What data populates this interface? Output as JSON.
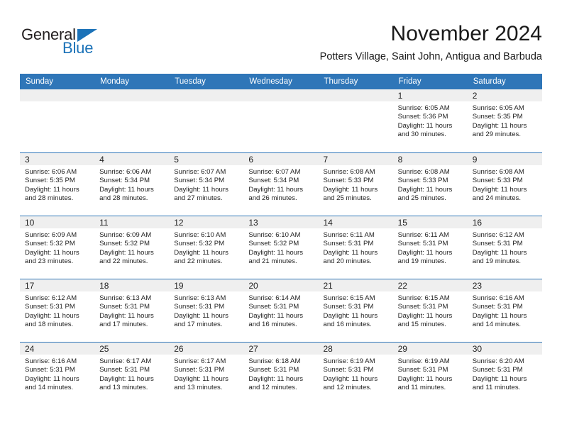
{
  "brand": {
    "name_top": "General",
    "name_bottom": "Blue",
    "triangle_color": "#1b72b8",
    "text_color": "#231f20"
  },
  "header": {
    "title": "November 2024",
    "subtitle": "Potters Village, Saint John, Antigua and Barbuda"
  },
  "colors": {
    "header_blue": "#2f76b8",
    "day_band_gray": "#efefef",
    "text": "#222222",
    "page_background": "#ffffff"
  },
  "calendar": {
    "weekdays": [
      "Sunday",
      "Monday",
      "Tuesday",
      "Wednesday",
      "Thursday",
      "Friday",
      "Saturday"
    ],
    "labels": {
      "sunrise_prefix": "Sunrise:",
      "sunset_prefix": "Sunset:",
      "daylight_prefix": "Daylight:"
    },
    "weeks": [
      [
        {
          "day": "",
          "sunrise": "",
          "sunset": "",
          "daylight": "",
          "empty": true
        },
        {
          "day": "",
          "sunrise": "",
          "sunset": "",
          "daylight": "",
          "empty": true
        },
        {
          "day": "",
          "sunrise": "",
          "sunset": "",
          "daylight": "",
          "empty": true
        },
        {
          "day": "",
          "sunrise": "",
          "sunset": "",
          "daylight": "",
          "empty": true
        },
        {
          "day": "",
          "sunrise": "",
          "sunset": "",
          "daylight": "",
          "empty": true
        },
        {
          "day": "1",
          "sunrise": "Sunrise: 6:05 AM",
          "sunset": "Sunset: 5:36 PM",
          "daylight": "Daylight: 11 hours and 30 minutes.",
          "empty": false
        },
        {
          "day": "2",
          "sunrise": "Sunrise: 6:05 AM",
          "sunset": "Sunset: 5:35 PM",
          "daylight": "Daylight: 11 hours and 29 minutes.",
          "empty": false
        }
      ],
      [
        {
          "day": "3",
          "sunrise": "Sunrise: 6:06 AM",
          "sunset": "Sunset: 5:35 PM",
          "daylight": "Daylight: 11 hours and 28 minutes.",
          "empty": false
        },
        {
          "day": "4",
          "sunrise": "Sunrise: 6:06 AM",
          "sunset": "Sunset: 5:34 PM",
          "daylight": "Daylight: 11 hours and 28 minutes.",
          "empty": false
        },
        {
          "day": "5",
          "sunrise": "Sunrise: 6:07 AM",
          "sunset": "Sunset: 5:34 PM",
          "daylight": "Daylight: 11 hours and 27 minutes.",
          "empty": false
        },
        {
          "day": "6",
          "sunrise": "Sunrise: 6:07 AM",
          "sunset": "Sunset: 5:34 PM",
          "daylight": "Daylight: 11 hours and 26 minutes.",
          "empty": false
        },
        {
          "day": "7",
          "sunrise": "Sunrise: 6:08 AM",
          "sunset": "Sunset: 5:33 PM",
          "daylight": "Daylight: 11 hours and 25 minutes.",
          "empty": false
        },
        {
          "day": "8",
          "sunrise": "Sunrise: 6:08 AM",
          "sunset": "Sunset: 5:33 PM",
          "daylight": "Daylight: 11 hours and 25 minutes.",
          "empty": false
        },
        {
          "day": "9",
          "sunrise": "Sunrise: 6:08 AM",
          "sunset": "Sunset: 5:33 PM",
          "daylight": "Daylight: 11 hours and 24 minutes.",
          "empty": false
        }
      ],
      [
        {
          "day": "10",
          "sunrise": "Sunrise: 6:09 AM",
          "sunset": "Sunset: 5:32 PM",
          "daylight": "Daylight: 11 hours and 23 minutes.",
          "empty": false
        },
        {
          "day": "11",
          "sunrise": "Sunrise: 6:09 AM",
          "sunset": "Sunset: 5:32 PM",
          "daylight": "Daylight: 11 hours and 22 minutes.",
          "empty": false
        },
        {
          "day": "12",
          "sunrise": "Sunrise: 6:10 AM",
          "sunset": "Sunset: 5:32 PM",
          "daylight": "Daylight: 11 hours and 22 minutes.",
          "empty": false
        },
        {
          "day": "13",
          "sunrise": "Sunrise: 6:10 AM",
          "sunset": "Sunset: 5:32 PM",
          "daylight": "Daylight: 11 hours and 21 minutes.",
          "empty": false
        },
        {
          "day": "14",
          "sunrise": "Sunrise: 6:11 AM",
          "sunset": "Sunset: 5:31 PM",
          "daylight": "Daylight: 11 hours and 20 minutes.",
          "empty": false
        },
        {
          "day": "15",
          "sunrise": "Sunrise: 6:11 AM",
          "sunset": "Sunset: 5:31 PM",
          "daylight": "Daylight: 11 hours and 19 minutes.",
          "empty": false
        },
        {
          "day": "16",
          "sunrise": "Sunrise: 6:12 AM",
          "sunset": "Sunset: 5:31 PM",
          "daylight": "Daylight: 11 hours and 19 minutes.",
          "empty": false
        }
      ],
      [
        {
          "day": "17",
          "sunrise": "Sunrise: 6:12 AM",
          "sunset": "Sunset: 5:31 PM",
          "daylight": "Daylight: 11 hours and 18 minutes.",
          "empty": false
        },
        {
          "day": "18",
          "sunrise": "Sunrise: 6:13 AM",
          "sunset": "Sunset: 5:31 PM",
          "daylight": "Daylight: 11 hours and 17 minutes.",
          "empty": false
        },
        {
          "day": "19",
          "sunrise": "Sunrise: 6:13 AM",
          "sunset": "Sunset: 5:31 PM",
          "daylight": "Daylight: 11 hours and 17 minutes.",
          "empty": false
        },
        {
          "day": "20",
          "sunrise": "Sunrise: 6:14 AM",
          "sunset": "Sunset: 5:31 PM",
          "daylight": "Daylight: 11 hours and 16 minutes.",
          "empty": false
        },
        {
          "day": "21",
          "sunrise": "Sunrise: 6:15 AM",
          "sunset": "Sunset: 5:31 PM",
          "daylight": "Daylight: 11 hours and 16 minutes.",
          "empty": false
        },
        {
          "day": "22",
          "sunrise": "Sunrise: 6:15 AM",
          "sunset": "Sunset: 5:31 PM",
          "daylight": "Daylight: 11 hours and 15 minutes.",
          "empty": false
        },
        {
          "day": "23",
          "sunrise": "Sunrise: 6:16 AM",
          "sunset": "Sunset: 5:31 PM",
          "daylight": "Daylight: 11 hours and 14 minutes.",
          "empty": false
        }
      ],
      [
        {
          "day": "24",
          "sunrise": "Sunrise: 6:16 AM",
          "sunset": "Sunset: 5:31 PM",
          "daylight": "Daylight: 11 hours and 14 minutes.",
          "empty": false
        },
        {
          "day": "25",
          "sunrise": "Sunrise: 6:17 AM",
          "sunset": "Sunset: 5:31 PM",
          "daylight": "Daylight: 11 hours and 13 minutes.",
          "empty": false
        },
        {
          "day": "26",
          "sunrise": "Sunrise: 6:17 AM",
          "sunset": "Sunset: 5:31 PM",
          "daylight": "Daylight: 11 hours and 13 minutes.",
          "empty": false
        },
        {
          "day": "27",
          "sunrise": "Sunrise: 6:18 AM",
          "sunset": "Sunset: 5:31 PM",
          "daylight": "Daylight: 11 hours and 12 minutes.",
          "empty": false
        },
        {
          "day": "28",
          "sunrise": "Sunrise: 6:19 AM",
          "sunset": "Sunset: 5:31 PM",
          "daylight": "Daylight: 11 hours and 12 minutes.",
          "empty": false
        },
        {
          "day": "29",
          "sunrise": "Sunrise: 6:19 AM",
          "sunset": "Sunset: 5:31 PM",
          "daylight": "Daylight: 11 hours and 11 minutes.",
          "empty": false
        },
        {
          "day": "30",
          "sunrise": "Sunrise: 6:20 AM",
          "sunset": "Sunset: 5:31 PM",
          "daylight": "Daylight: 11 hours and 11 minutes.",
          "empty": false
        }
      ]
    ]
  }
}
